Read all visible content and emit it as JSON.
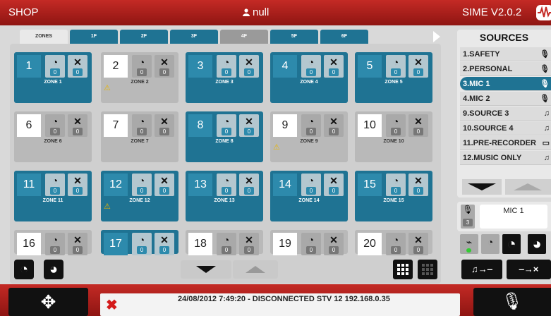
{
  "header": {
    "app_name": "SHOP",
    "user_name": "null",
    "version": "SIME V2.0.2"
  },
  "tabs": [
    {
      "label": "ZONES",
      "active": true
    },
    {
      "label": "1F"
    },
    {
      "label": "2F"
    },
    {
      "label": "3F"
    },
    {
      "label": "4F",
      "style": "gray"
    },
    {
      "label": "5F"
    },
    {
      "label": "6F"
    }
  ],
  "zones": [
    {
      "num": "1",
      "name": "ZONE 1",
      "style": "blue",
      "c1": "0",
      "c2": "0",
      "warn": false
    },
    {
      "num": "2",
      "name": "ZONE 2",
      "style": "white",
      "c1": "0",
      "c2": "0",
      "warn": true
    },
    {
      "num": "3",
      "name": "ZONE 3",
      "style": "blue",
      "c1": "0",
      "c2": "0",
      "warn": false
    },
    {
      "num": "4",
      "name": "ZONE 4",
      "style": "blue",
      "c1": "0",
      "c2": "0",
      "warn": false
    },
    {
      "num": "5",
      "name": "ZONE 5",
      "style": "blue",
      "c1": "0",
      "c2": "0",
      "warn": false
    },
    {
      "num": "6",
      "name": "ZONE 6",
      "style": "white",
      "c1": "0",
      "c2": "0",
      "warn": false
    },
    {
      "num": "7",
      "name": "ZONE 7",
      "style": "white",
      "c1": "0",
      "c2": "0",
      "warn": false
    },
    {
      "num": "8",
      "name": "ZONE 8",
      "style": "blue",
      "c1": "0",
      "c2": "0",
      "warn": false
    },
    {
      "num": "9",
      "name": "ZONE 9",
      "style": "white",
      "c1": "0",
      "c2": "0",
      "warn": true
    },
    {
      "num": "10",
      "name": "ZONE 10",
      "style": "white",
      "c1": "0",
      "c2": "0",
      "warn": false
    },
    {
      "num": "11",
      "name": "ZONE 11",
      "style": "blue",
      "c1": "0",
      "c2": "0",
      "warn": false
    },
    {
      "num": "12",
      "name": "ZONE 12",
      "style": "blue",
      "c1": "0",
      "c2": "0",
      "warn": true
    },
    {
      "num": "13",
      "name": "ZONE 13",
      "style": "blue",
      "c1": "0",
      "c2": "0",
      "warn": false
    },
    {
      "num": "14",
      "name": "ZONE 14",
      "style": "blue",
      "c1": "0",
      "c2": "0",
      "warn": false
    },
    {
      "num": "15",
      "name": "ZONE 15",
      "style": "blue",
      "c1": "0",
      "c2": "0",
      "warn": false
    },
    {
      "num": "16",
      "name": "",
      "style": "white",
      "c1": "0",
      "c2": "0",
      "warn": false
    },
    {
      "num": "17",
      "name": "",
      "style": "blue",
      "c1": "0",
      "c2": "0",
      "warn": false
    },
    {
      "num": "18",
      "name": "",
      "style": "white",
      "c1": "0",
      "c2": "0",
      "warn": false
    },
    {
      "num": "19",
      "name": "",
      "style": "white",
      "c1": "0",
      "c2": "0",
      "warn": false
    },
    {
      "num": "20",
      "name": "",
      "style": "white",
      "c1": "0",
      "c2": "0",
      "warn": false
    }
  ],
  "sources": {
    "title": "SOURCES",
    "items": [
      {
        "label": "1.SAFETY",
        "icon": "mic-icon",
        "glyph": "🎙"
      },
      {
        "label": "2.PERSONAL",
        "icon": "mic-icon",
        "glyph": "🎙"
      },
      {
        "label": "3.MIC 1",
        "icon": "mic-icon",
        "glyph": "🎙",
        "active": true
      },
      {
        "label": "4.MIC 2",
        "icon": "mic-icon",
        "glyph": "🎙"
      },
      {
        "label": "9.SOURCE 3",
        "icon": "music-icon",
        "glyph": "♫"
      },
      {
        "label": "10.SOURCE 4",
        "icon": "music-icon",
        "glyph": "♫"
      },
      {
        "label": "11.PRE-RECORDER",
        "icon": "recorder-icon",
        "glyph": "▭"
      },
      {
        "label": "12.MUSIC ONLY",
        "icon": "music-icon",
        "glyph": "♫"
      }
    ]
  },
  "mic_panel": {
    "label": "MIC 1",
    "count": "3"
  },
  "status": {
    "message": "24/08/2012 7:49:20 - DISCONNECTED STV 12 192.168.0.35"
  },
  "colors": {
    "header_red": "#c42a25",
    "zone_blue": "#1f7393",
    "warning": "#e8b500",
    "error": "#d41a1a"
  }
}
